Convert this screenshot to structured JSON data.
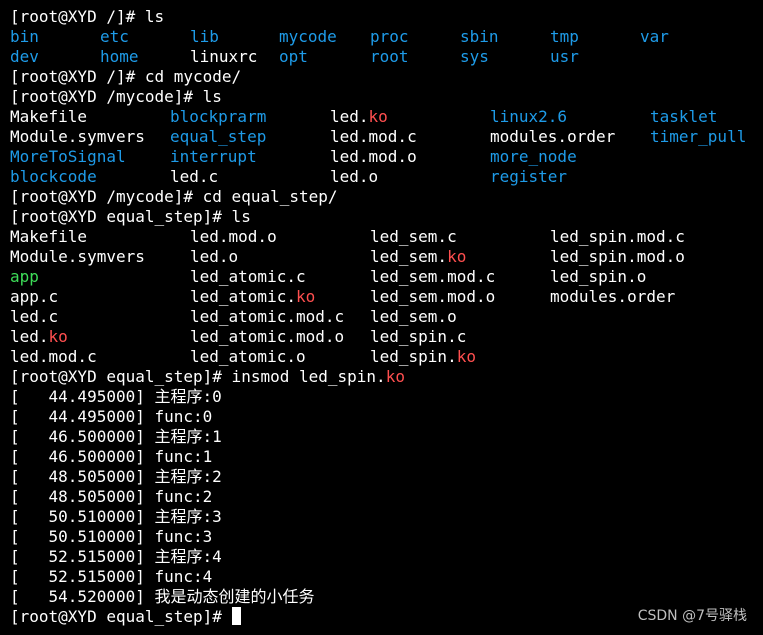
{
  "colors": {
    "background": "#000000",
    "text": "#ffffff",
    "directory": "#1e9be8",
    "kernel_object": "#ff4f4f",
    "executable": "#3ddc58"
  },
  "terminal": {
    "lines": [
      {
        "kind": "text",
        "segments": [
          {
            "text": "[root@XYD /]# ls",
            "color": "white"
          }
        ]
      },
      {
        "kind": "grid",
        "cells": [
          {
            "col": 0,
            "segments": [
              {
                "text": "bin",
                "color": "blue"
              }
            ]
          },
          {
            "col": 1,
            "segments": [
              {
                "text": "etc",
                "color": "blue"
              }
            ]
          },
          {
            "col": 2,
            "segments": [
              {
                "text": "lib",
                "color": "blue"
              }
            ]
          },
          {
            "col": 3,
            "segments": [
              {
                "text": "mycode",
                "color": "blue"
              }
            ]
          },
          {
            "col": 4,
            "segments": [
              {
                "text": "proc",
                "color": "blue"
              }
            ]
          },
          {
            "col": 5,
            "segments": [
              {
                "text": "sbin",
                "color": "blue"
              }
            ]
          },
          {
            "col": 6,
            "segments": [
              {
                "text": "tmp",
                "color": "blue"
              }
            ]
          },
          {
            "col": 7,
            "segments": [
              {
                "text": "var",
                "color": "blue"
              }
            ]
          }
        ]
      },
      {
        "kind": "grid",
        "cells": [
          {
            "col": 0,
            "segments": [
              {
                "text": "dev",
                "color": "blue"
              }
            ]
          },
          {
            "col": 1,
            "segments": [
              {
                "text": "home",
                "color": "blue"
              }
            ]
          },
          {
            "col": 2,
            "segments": [
              {
                "text": "linuxrc",
                "color": "white"
              }
            ]
          },
          {
            "col": 3,
            "segments": [
              {
                "text": "opt",
                "color": "blue"
              }
            ]
          },
          {
            "col": 4,
            "segments": [
              {
                "text": "root",
                "color": "blue"
              }
            ]
          },
          {
            "col": 5,
            "segments": [
              {
                "text": "sys",
                "color": "blue"
              }
            ]
          },
          {
            "col": 6,
            "segments": [
              {
                "text": "usr",
                "color": "blue"
              }
            ]
          }
        ]
      },
      {
        "kind": "text",
        "segments": [
          {
            "text": "[root@XYD /]# cd mycode/",
            "color": "white"
          }
        ]
      },
      {
        "kind": "text",
        "segments": [
          {
            "text": "[root@XYD /mycode]# ls",
            "color": "white"
          }
        ]
      },
      {
        "kind": "grid",
        "cells": [
          {
            "col": 0,
            "segments": [
              {
                "text": "Makefile",
                "color": "white"
              }
            ]
          },
          {
            "col": 1,
            "segments": [
              {
                "text": "blockprarm",
                "color": "blue"
              }
            ]
          },
          {
            "col": 2,
            "segments": [
              {
                "text": "led.",
                "color": "white"
              },
              {
                "text": "ko",
                "color": "red"
              }
            ]
          },
          {
            "col": 3,
            "segments": [
              {
                "text": "linux2.6",
                "color": "blue"
              }
            ]
          },
          {
            "col": 4,
            "segments": [
              {
                "text": "tasklet",
                "color": "blue"
              }
            ]
          }
        ]
      },
      {
        "kind": "grid",
        "cells": [
          {
            "col": 0,
            "segments": [
              {
                "text": "Module.symvers",
                "color": "white"
              }
            ]
          },
          {
            "col": 1,
            "segments": [
              {
                "text": "equal_step",
                "color": "blue"
              }
            ]
          },
          {
            "col": 2,
            "segments": [
              {
                "text": "led.mod.c",
                "color": "white"
              }
            ]
          },
          {
            "col": 3,
            "segments": [
              {
                "text": "modules.order",
                "color": "white"
              }
            ]
          },
          {
            "col": 4,
            "segments": [
              {
                "text": "timer_pull",
                "color": "blue"
              }
            ]
          }
        ]
      },
      {
        "kind": "grid",
        "cells": [
          {
            "col": 0,
            "segments": [
              {
                "text": "MoreToSignal",
                "color": "blue"
              }
            ]
          },
          {
            "col": 1,
            "segments": [
              {
                "text": "interrupt",
                "color": "blue"
              }
            ]
          },
          {
            "col": 2,
            "segments": [
              {
                "text": "led.mod.o",
                "color": "white"
              }
            ]
          },
          {
            "col": 3,
            "segments": [
              {
                "text": "more_node",
                "color": "blue"
              }
            ]
          }
        ]
      },
      {
        "kind": "grid",
        "cells": [
          {
            "col": 0,
            "segments": [
              {
                "text": "blockcode",
                "color": "blue"
              }
            ]
          },
          {
            "col": 1,
            "segments": [
              {
                "text": "led.c",
                "color": "white"
              }
            ]
          },
          {
            "col": 2,
            "segments": [
              {
                "text": "led.o",
                "color": "white"
              }
            ]
          },
          {
            "col": 3,
            "segments": [
              {
                "text": "register",
                "color": "blue"
              }
            ]
          }
        ]
      },
      {
        "kind": "text",
        "segments": [
          {
            "text": "[root@XYD /mycode]# cd equal_step/",
            "color": "white"
          }
        ]
      },
      {
        "kind": "text",
        "segments": [
          {
            "text": "[root@XYD equal_step]# ls",
            "color": "white"
          }
        ]
      },
      {
        "kind": "grid",
        "cells": [
          {
            "col": 0,
            "segments": [
              {
                "text": "Makefile",
                "color": "white"
              }
            ]
          },
          {
            "col": 1,
            "segments": [
              {
                "text": "led.mod.o",
                "color": "white"
              }
            ]
          },
          {
            "col": 2,
            "segments": [
              {
                "text": "led_sem.c",
                "color": "white"
              }
            ]
          },
          {
            "col": 3,
            "segments": [
              {
                "text": "led_spin.mod.c",
                "color": "white"
              }
            ]
          }
        ]
      },
      {
        "kind": "grid",
        "cells": [
          {
            "col": 0,
            "segments": [
              {
                "text": "Module.symvers",
                "color": "white"
              }
            ]
          },
          {
            "col": 1,
            "segments": [
              {
                "text": "led.o",
                "color": "white"
              }
            ]
          },
          {
            "col": 2,
            "segments": [
              {
                "text": "led_sem.",
                "color": "white"
              },
              {
                "text": "ko",
                "color": "red"
              }
            ]
          },
          {
            "col": 3,
            "segments": [
              {
                "text": "led_spin.mod.o",
                "color": "white"
              }
            ]
          }
        ]
      },
      {
        "kind": "grid",
        "cells": [
          {
            "col": 0,
            "segments": [
              {
                "text": "app",
                "color": "green"
              }
            ]
          },
          {
            "col": 1,
            "segments": [
              {
                "text": "led_atomic.c",
                "color": "white"
              }
            ]
          },
          {
            "col": 2,
            "segments": [
              {
                "text": "led_sem.mod.c",
                "color": "white"
              }
            ]
          },
          {
            "col": 3,
            "segments": [
              {
                "text": "led_spin.o",
                "color": "white"
              }
            ]
          }
        ]
      },
      {
        "kind": "grid",
        "cells": [
          {
            "col": 0,
            "segments": [
              {
                "text": "app.c",
                "color": "white"
              }
            ]
          },
          {
            "col": 1,
            "segments": [
              {
                "text": "led_atomic.",
                "color": "white"
              },
              {
                "text": "ko",
                "color": "red"
              }
            ]
          },
          {
            "col": 2,
            "segments": [
              {
                "text": "led_sem.mod.o",
                "color": "white"
              }
            ]
          },
          {
            "col": 3,
            "segments": [
              {
                "text": "modules.order",
                "color": "white"
              }
            ]
          }
        ]
      },
      {
        "kind": "grid",
        "cells": [
          {
            "col": 0,
            "segments": [
              {
                "text": "led.c",
                "color": "white"
              }
            ]
          },
          {
            "col": 1,
            "segments": [
              {
                "text": "led_atomic.mod.c",
                "color": "white"
              }
            ]
          },
          {
            "col": 2,
            "segments": [
              {
                "text": "led_sem.o",
                "color": "white"
              }
            ]
          }
        ]
      },
      {
        "kind": "grid",
        "cells": [
          {
            "col": 0,
            "segments": [
              {
                "text": "led.",
                "color": "white"
              },
              {
                "text": "ko",
                "color": "red"
              }
            ]
          },
          {
            "col": 1,
            "segments": [
              {
                "text": "led_atomic.mod.o",
                "color": "white"
              }
            ]
          },
          {
            "col": 2,
            "segments": [
              {
                "text": "led_spin.c",
                "color": "white"
              }
            ]
          }
        ]
      },
      {
        "kind": "grid",
        "cells": [
          {
            "col": 0,
            "segments": [
              {
                "text": "led.mod.c",
                "color": "white"
              }
            ]
          },
          {
            "col": 1,
            "segments": [
              {
                "text": "led_atomic.o",
                "color": "white"
              }
            ]
          },
          {
            "col": 2,
            "segments": [
              {
                "text": "led_spin.",
                "color": "white"
              },
              {
                "text": "ko",
                "color": "red"
              }
            ]
          }
        ]
      },
      {
        "kind": "text",
        "segments": [
          {
            "text": "[root@XYD equal_step]# insmod led_spin.",
            "color": "white"
          },
          {
            "text": "ko",
            "color": "red"
          }
        ]
      },
      {
        "kind": "text",
        "segments": [
          {
            "text": "[   44.495000] 主程序:0",
            "color": "white"
          }
        ]
      },
      {
        "kind": "text",
        "segments": [
          {
            "text": "[   44.495000] func:0",
            "color": "white"
          }
        ]
      },
      {
        "kind": "text",
        "segments": [
          {
            "text": "[   46.500000] 主程序:1",
            "color": "white"
          }
        ]
      },
      {
        "kind": "text",
        "segments": [
          {
            "text": "[   46.500000] func:1",
            "color": "white"
          }
        ]
      },
      {
        "kind": "text",
        "segments": [
          {
            "text": "[   48.505000] 主程序:2",
            "color": "white"
          }
        ]
      },
      {
        "kind": "text",
        "segments": [
          {
            "text": "[   48.505000] func:2",
            "color": "white"
          }
        ]
      },
      {
        "kind": "text",
        "segments": [
          {
            "text": "[   50.510000] 主程序:3",
            "color": "white"
          }
        ]
      },
      {
        "kind": "text",
        "segments": [
          {
            "text": "[   50.510000] func:3",
            "color": "white"
          }
        ]
      },
      {
        "kind": "text",
        "segments": [
          {
            "text": "[   52.515000] 主程序:4",
            "color": "white"
          }
        ]
      },
      {
        "kind": "text",
        "segments": [
          {
            "text": "[   52.515000] func:4",
            "color": "white"
          }
        ]
      },
      {
        "kind": "text",
        "segments": [
          {
            "text": "[   54.520000] 我是动态创建的小任务",
            "color": "white"
          }
        ]
      },
      {
        "kind": "prompt",
        "segments": [
          {
            "text": "[root@XYD equal_step]# ",
            "color": "white"
          }
        ]
      }
    ]
  },
  "watermark": "CSDN @7号驿栈"
}
